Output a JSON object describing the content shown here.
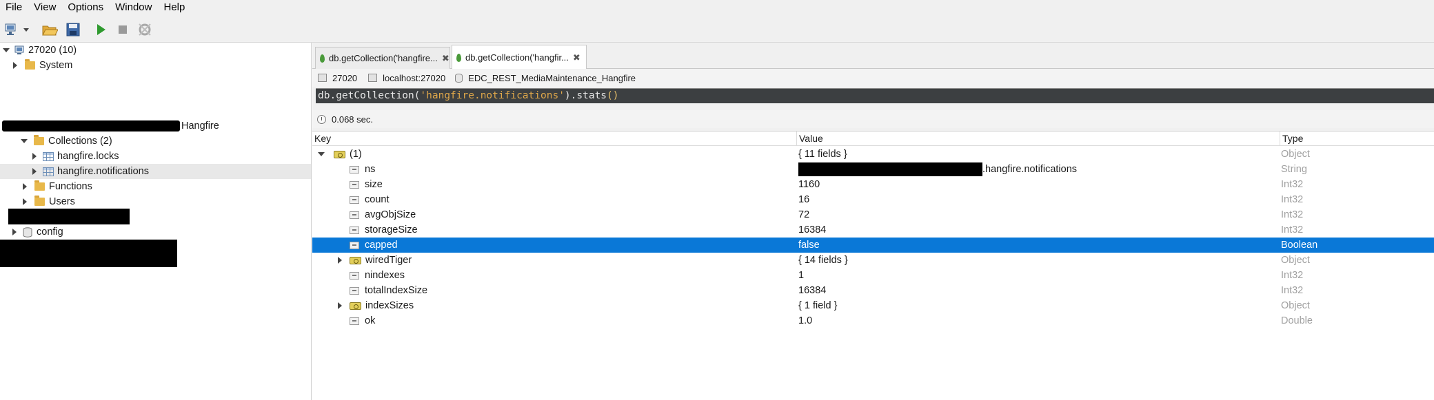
{
  "menu": [
    "File",
    "View",
    "Options",
    "Window",
    "Help"
  ],
  "toolbar": {
    "icons": [
      "connect-icon",
      "dropdown-icon",
      "open-icon",
      "save-icon",
      "run-icon",
      "stop-icon",
      "refresh-icon"
    ]
  },
  "tree": {
    "server_label": "27020 (10)",
    "system_label": "System",
    "db_suffix": "Hangfire",
    "collections_label": "Collections (2)",
    "collection_1": "hangfire.locks",
    "collection_2": "hangfire.notifications",
    "functions_label": "Functions",
    "users_label": "Users",
    "config_label": "config"
  },
  "tabs": [
    {
      "label": "db.getCollection('hangfire...",
      "close": "✖"
    },
    {
      "label": "db.getCollection('hangfir...",
      "close": "✖"
    }
  ],
  "info": {
    "port": "27020",
    "host": "localhost:27020",
    "database": "EDC_REST_MediaMaintenance_Hangfire"
  },
  "query": {
    "prefix": "db.getCollection(",
    "string": "'hangfire.notifications'",
    "suffix": ").stats",
    "parens": "()"
  },
  "timing": "0.068 sec.",
  "columns": {
    "key": "Key",
    "value": "Value",
    "type": "Type"
  },
  "rows": [
    {
      "key": "(1)",
      "value": "{ 11 fields }",
      "type": "Object"
    },
    {
      "key": "ns",
      "value": ".hangfire.notifications",
      "type": "String"
    },
    {
      "key": "size",
      "value": "1160",
      "type": "Int32"
    },
    {
      "key": "count",
      "value": "16",
      "type": "Int32"
    },
    {
      "key": "avgObjSize",
      "value": "72",
      "type": "Int32"
    },
    {
      "key": "storageSize",
      "value": "16384",
      "type": "Int32"
    },
    {
      "key": "capped",
      "value": "false",
      "type": "Boolean"
    },
    {
      "key": "wiredTiger",
      "value": "{ 14 fields }",
      "type": "Object"
    },
    {
      "key": "nindexes",
      "value": "1",
      "type": "Int32"
    },
    {
      "key": "totalIndexSize",
      "value": "16384",
      "type": "Int32"
    },
    {
      "key": "indexSizes",
      "value": "{ 1 field }",
      "type": "Object"
    },
    {
      "key": "ok",
      "value": "1.0",
      "type": "Double"
    }
  ],
  "colors": {
    "selection": "#0a78d7",
    "query_bg": "#3c3f41",
    "query_string": "#e0a84a"
  }
}
